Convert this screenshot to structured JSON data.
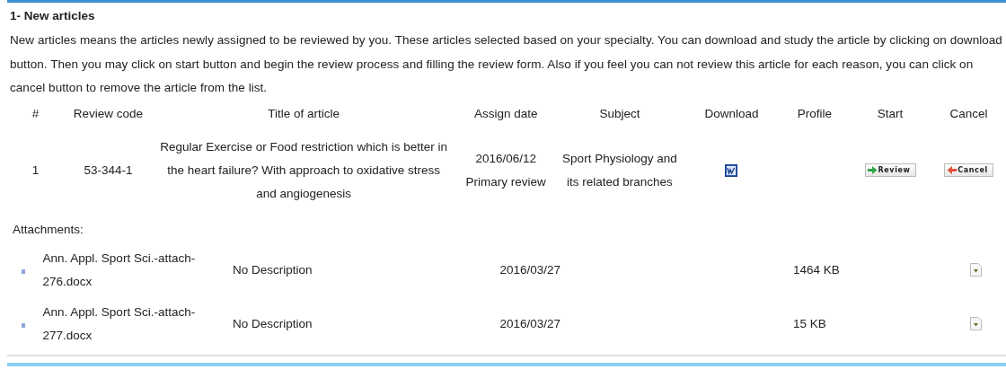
{
  "section": {
    "heading": "1- New articles",
    "description": "New articles means the articles newly assigned to be reviewed by you. These articles selected based on your specialty. You can download and study the article by clicking on download button. Then you may click on start button and begin the review process and filling the review form. Also if you feel you can not review this article for each reason, you can click on cancel button to remove the article from the list."
  },
  "table": {
    "columns": [
      "#",
      "Review code",
      "Title of article",
      "Assign date",
      "Subject",
      "Download",
      "Profile",
      "Start",
      "Cancel"
    ],
    "rows": [
      {
        "number": "1",
        "review_code": "53-344-1",
        "title": "Regular Exercise or Food restriction which is better in the heart failure? With approach to oxidative stress and angiogenesis",
        "assign_date": "2016/06/12",
        "review_type": "Primary review",
        "subject": "Sport Physiology and its related branches",
        "start_button": "Review",
        "cancel_button": "Cancel"
      }
    ]
  },
  "attachments": {
    "label": "Attachments:",
    "items": [
      {
        "name": "Ann. Appl. Sport Sci.-attach-276.docx",
        "description": "No Description",
        "date": "2016/03/27",
        "size": "1464 KB"
      },
      {
        "name": "Ann. Appl. Sport Sci.-attach-277.docx",
        "description": "No Description",
        "date": "2016/03/27",
        "size": "15 KB"
      }
    ]
  }
}
